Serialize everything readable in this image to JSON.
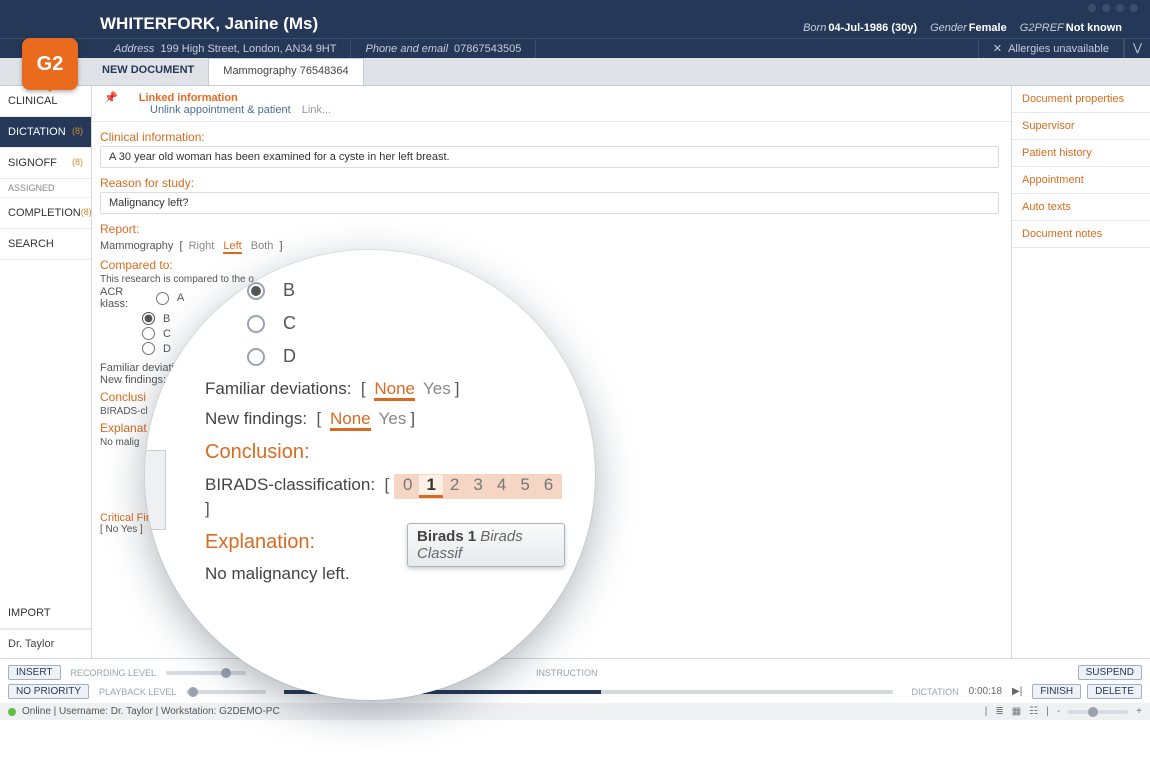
{
  "banner": {
    "patient_name": "WHITERFORK, Janine (Ms)",
    "born_label": "Born",
    "born_value": "04-Jul-1986 (30y)",
    "gender_label": "Gender",
    "gender_value": "Female",
    "g2pref_label": "G2PREF",
    "g2pref_value": "Not known",
    "address_label": "Address",
    "address_value": "199 High Street, London, AN34 9HT",
    "phone_label": "Phone and email",
    "phone_value": "07867543505",
    "allergies": "Allergies unavailable"
  },
  "logo": "G2",
  "tabs": {
    "new": "NEW DOCUMENT",
    "active": "Mammography 76548364"
  },
  "left_nav": {
    "items": [
      {
        "label": "CLINICAL",
        "badge": ""
      },
      {
        "label": "DICTATION",
        "badge": "(8)"
      },
      {
        "label": "SIGNOFF",
        "badge": "(8)"
      },
      {
        "label": "COMPLETION",
        "badge": "(8)"
      },
      {
        "label": "SEARCH",
        "badge": ""
      }
    ],
    "assigned": "ASSIGNED",
    "import": "IMPORT",
    "user": "Dr. Taylor"
  },
  "linked": {
    "title": "Linked information",
    "unlink": "Unlink appointment & patient",
    "linkmore": "Link..."
  },
  "doc": {
    "clinical_h": "Clinical information:",
    "clinical_v": "A 30 year old woman has been examined for a cyste in her left breast.",
    "reason_h": "Reason for study:",
    "reason_v": "Malignancy left?",
    "report_h": "Report:",
    "mamm_label": "Mammography",
    "sides": {
      "right": "Right",
      "left": "Left",
      "both": "Both"
    },
    "compared_h": "Compared to:",
    "compared_note": "This research is compared to the o",
    "acr_label": "ACR klass:",
    "acr_options": [
      "A",
      "B",
      "C",
      "D"
    ],
    "familiar_label": "Familiar deviations:",
    "newfind_label": "New findings:",
    "none": "None",
    "yes": "Yes",
    "conclusion_h": "Conclusion:",
    "birads_label": "BIRADS-classification:",
    "birads_values": [
      "0",
      "1",
      "2",
      "3",
      "4",
      "5",
      "6"
    ],
    "birads_selected": "1",
    "explanation_h": "Explanation:",
    "explanation_v": "No malignancy left.",
    "critical_h": "Critical Findings:",
    "critical_line": "[ No  Yes ]",
    "tooltip_bold": "Birads 1",
    "tooltip_italic": "Birads Classif"
  },
  "right_nav": [
    "Document properties",
    "Supervisor",
    "Patient history",
    "Appointment",
    "Auto texts",
    "Document notes"
  ],
  "footer": {
    "insert": "INSERT",
    "priority": "NO PRIORITY",
    "rec": "RECORDING LEVEL",
    "play": "PLAYBACK LEVEL",
    "instruction": "INSTRUCTION",
    "dictation": "DICTATION",
    "time": "0:00:18",
    "suspend": "SUSPEND",
    "finish": "FINISH",
    "delete": "DELETE",
    "status": "Online | Username: Dr. Taylor | Workstation: G2DEMO-PC"
  }
}
